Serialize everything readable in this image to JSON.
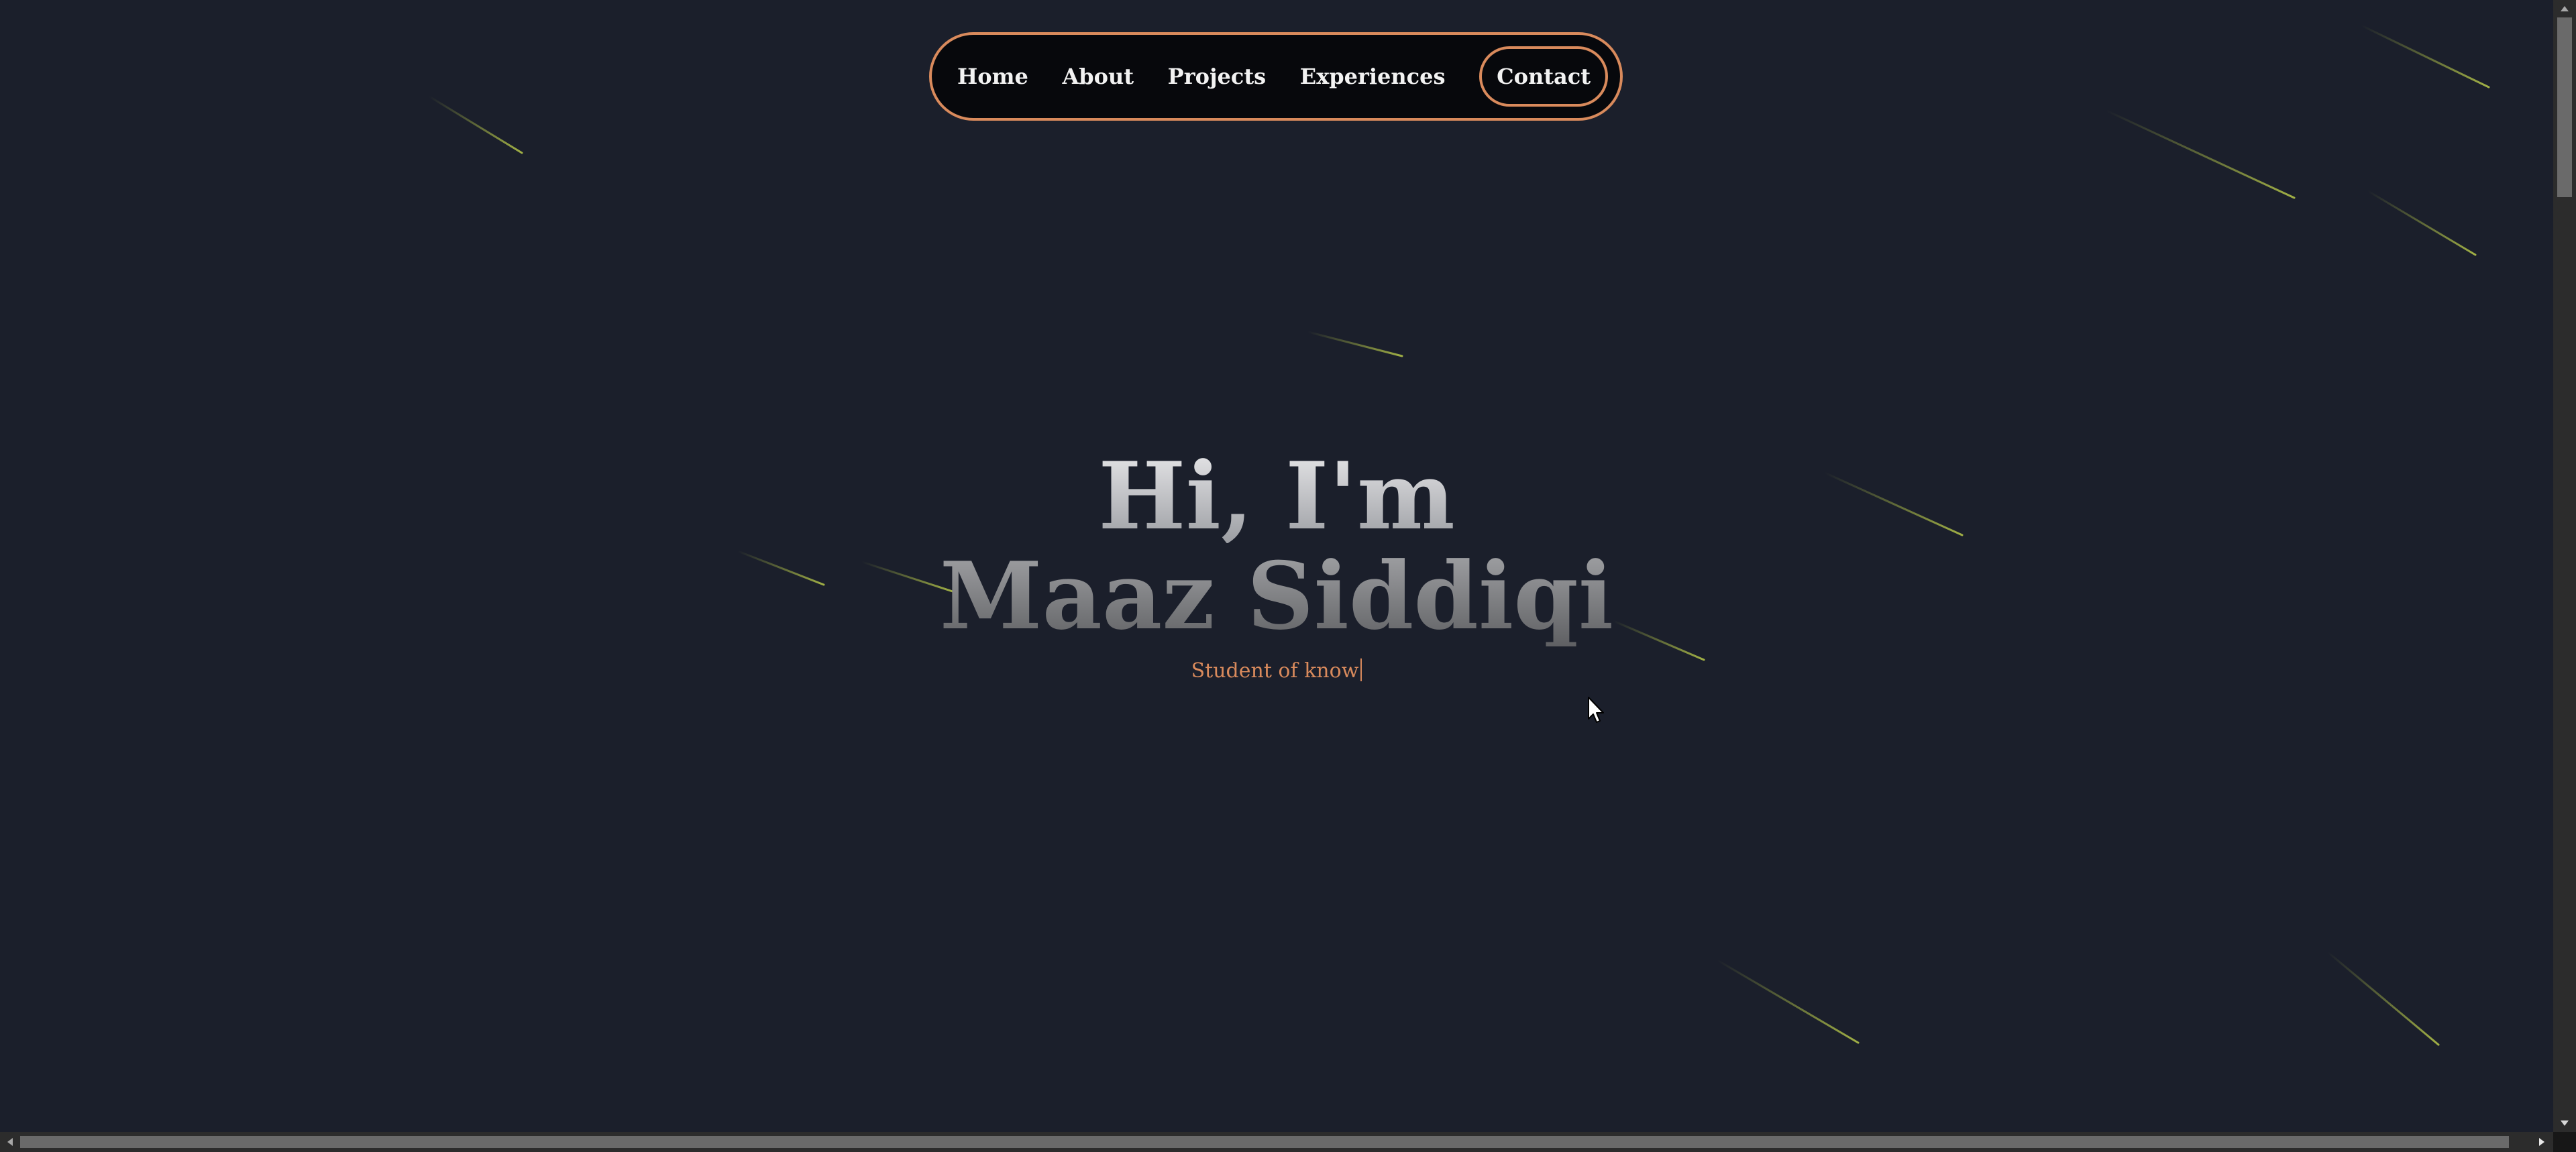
{
  "nav": {
    "items": [
      {
        "label": "Home"
      },
      {
        "label": "About"
      },
      {
        "label": "Projects"
      },
      {
        "label": "Experiences"
      },
      {
        "label": "Contact"
      }
    ]
  },
  "hero": {
    "line1": "Hi, I'm",
    "line2": "Maaz Siddiqi",
    "typed_text": "Student of know"
  },
  "colors": {
    "background": "#1b1f2b",
    "accent": "#d98a5c",
    "nav_bg": "#07080c",
    "streak": "#b8c94a"
  },
  "icons": {
    "cursor": "mouse-pointer-icon",
    "scroll_up": "triangle-up-icon",
    "scroll_down": "triangle-down-icon",
    "scroll_left": "triangle-left-icon",
    "scroll_right": "triangle-right-icon"
  }
}
